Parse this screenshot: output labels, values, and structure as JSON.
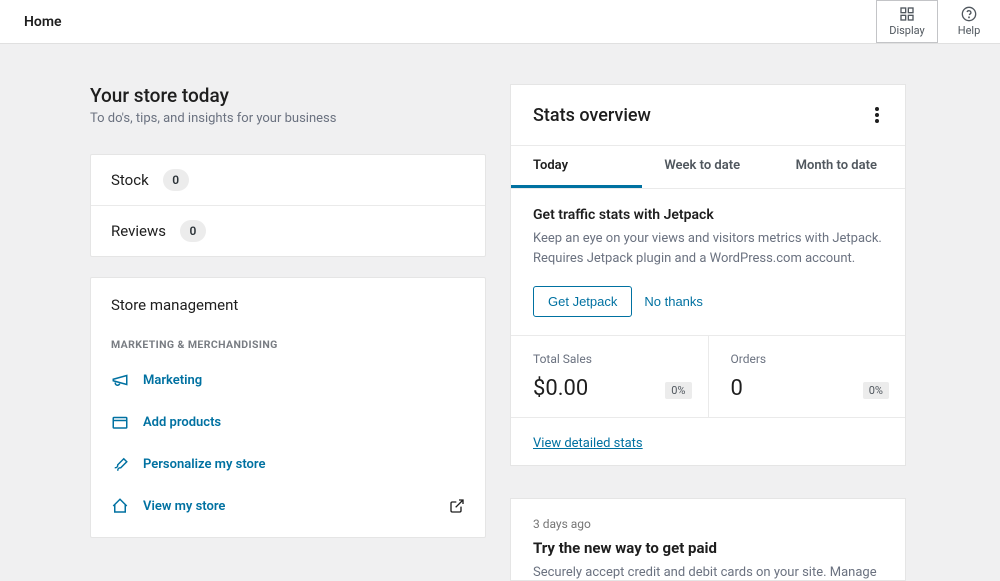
{
  "topbar": {
    "title": "Home",
    "display_label": "Display",
    "help_label": "Help"
  },
  "hero": {
    "title": "Your store today",
    "subtitle": "To do's, tips, and insights for your business"
  },
  "inbox": [
    {
      "label": "Stock",
      "count": "0"
    },
    {
      "label": "Reviews",
      "count": "0"
    }
  ],
  "mgmt": {
    "title": "Store management",
    "section_label": "MARKETING & MERCHANDISING",
    "items": [
      {
        "label": "Marketing"
      },
      {
        "label": "Add products"
      },
      {
        "label": "Personalize my store"
      },
      {
        "label": "View my store",
        "external": true
      }
    ]
  },
  "stats": {
    "title": "Stats overview",
    "tabs": [
      "Today",
      "Week to date",
      "Month to date"
    ],
    "active_tab": 0,
    "promo": {
      "title": "Get traffic stats with Jetpack",
      "text": "Keep an eye on your views and visitors metrics with Jetpack. Requires Jetpack plugin and a WordPress.com account.",
      "primary": "Get Jetpack",
      "secondary": "No thanks"
    },
    "metrics": [
      {
        "label": "Total Sales",
        "value": "$0.00",
        "delta": "0%"
      },
      {
        "label": "Orders",
        "value": "0",
        "delta": "0%"
      }
    ],
    "footer_link": "View detailed stats"
  },
  "feed": {
    "time": "3 days ago",
    "title": "Try the new way to get paid",
    "text": "Securely accept credit and debit cards on your site. Manage"
  }
}
